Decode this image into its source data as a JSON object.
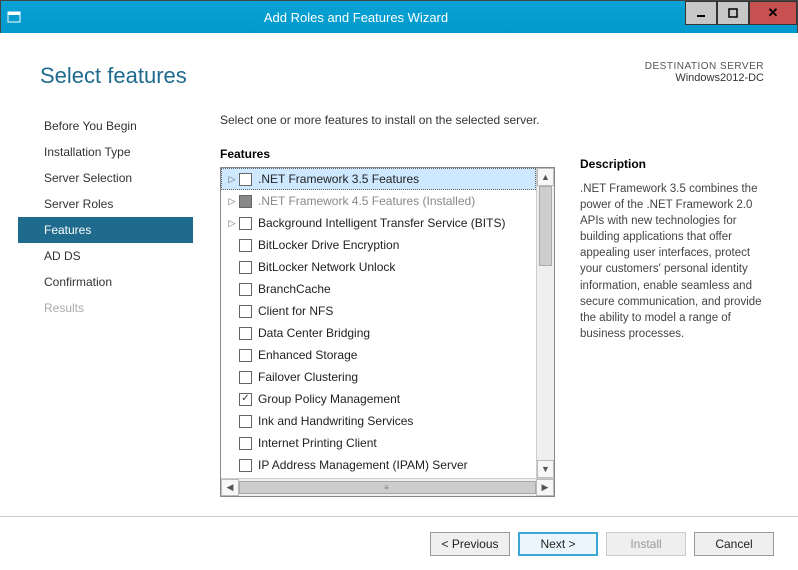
{
  "window": {
    "title": "Add Roles and Features Wizard"
  },
  "header": {
    "page_title": "Select features",
    "destination_label": "DESTINATION SERVER",
    "destination_value": "Windows2012-DC"
  },
  "nav": {
    "items": [
      {
        "label": "Before You Begin",
        "state": "normal"
      },
      {
        "label": "Installation Type",
        "state": "normal"
      },
      {
        "label": "Server Selection",
        "state": "normal"
      },
      {
        "label": "Server Roles",
        "state": "normal"
      },
      {
        "label": "Features",
        "state": "current"
      },
      {
        "label": "AD DS",
        "state": "normal"
      },
      {
        "label": "Confirmation",
        "state": "normal"
      },
      {
        "label": "Results",
        "state": "disabled"
      }
    ]
  },
  "content": {
    "instruction": "Select one or more features to install on the selected server.",
    "features_header": "Features",
    "description_header": "Description",
    "description_body": ".NET Framework 3.5 combines the power of the .NET Framework 2.0 APIs with new technologies for building applications that offer appealing user interfaces, protect your customers' personal identity information, enable seamless and secure communication, and provide the ability to model a range of business processes.",
    "features": [
      {
        "label": ".NET Framework 3.5 Features",
        "expandable": true,
        "checked": false,
        "selected": true,
        "disabled": false
      },
      {
        "label": ".NET Framework 4.5 Features (Installed)",
        "expandable": true,
        "checked": "partial",
        "selected": false,
        "disabled": true
      },
      {
        "label": "Background Intelligent Transfer Service (BITS)",
        "expandable": true,
        "checked": false,
        "selected": false,
        "disabled": false
      },
      {
        "label": "BitLocker Drive Encryption",
        "expandable": false,
        "checked": false,
        "selected": false,
        "disabled": false
      },
      {
        "label": "BitLocker Network Unlock",
        "expandable": false,
        "checked": false,
        "selected": false,
        "disabled": false
      },
      {
        "label": "BranchCache",
        "expandable": false,
        "checked": false,
        "selected": false,
        "disabled": false
      },
      {
        "label": "Client for NFS",
        "expandable": false,
        "checked": false,
        "selected": false,
        "disabled": false
      },
      {
        "label": "Data Center Bridging",
        "expandable": false,
        "checked": false,
        "selected": false,
        "disabled": false
      },
      {
        "label": "Enhanced Storage",
        "expandable": false,
        "checked": false,
        "selected": false,
        "disabled": false
      },
      {
        "label": "Failover Clustering",
        "expandable": false,
        "checked": false,
        "selected": false,
        "disabled": false
      },
      {
        "label": "Group Policy Management",
        "expandable": false,
        "checked": true,
        "selected": false,
        "disabled": false
      },
      {
        "label": "Ink and Handwriting Services",
        "expandable": false,
        "checked": false,
        "selected": false,
        "disabled": false
      },
      {
        "label": "Internet Printing Client",
        "expandable": false,
        "checked": false,
        "selected": false,
        "disabled": false
      },
      {
        "label": "IP Address Management (IPAM) Server",
        "expandable": false,
        "checked": false,
        "selected": false,
        "disabled": false
      }
    ]
  },
  "footer": {
    "previous": "< Previous",
    "next": "Next >",
    "install": "Install",
    "cancel": "Cancel"
  }
}
